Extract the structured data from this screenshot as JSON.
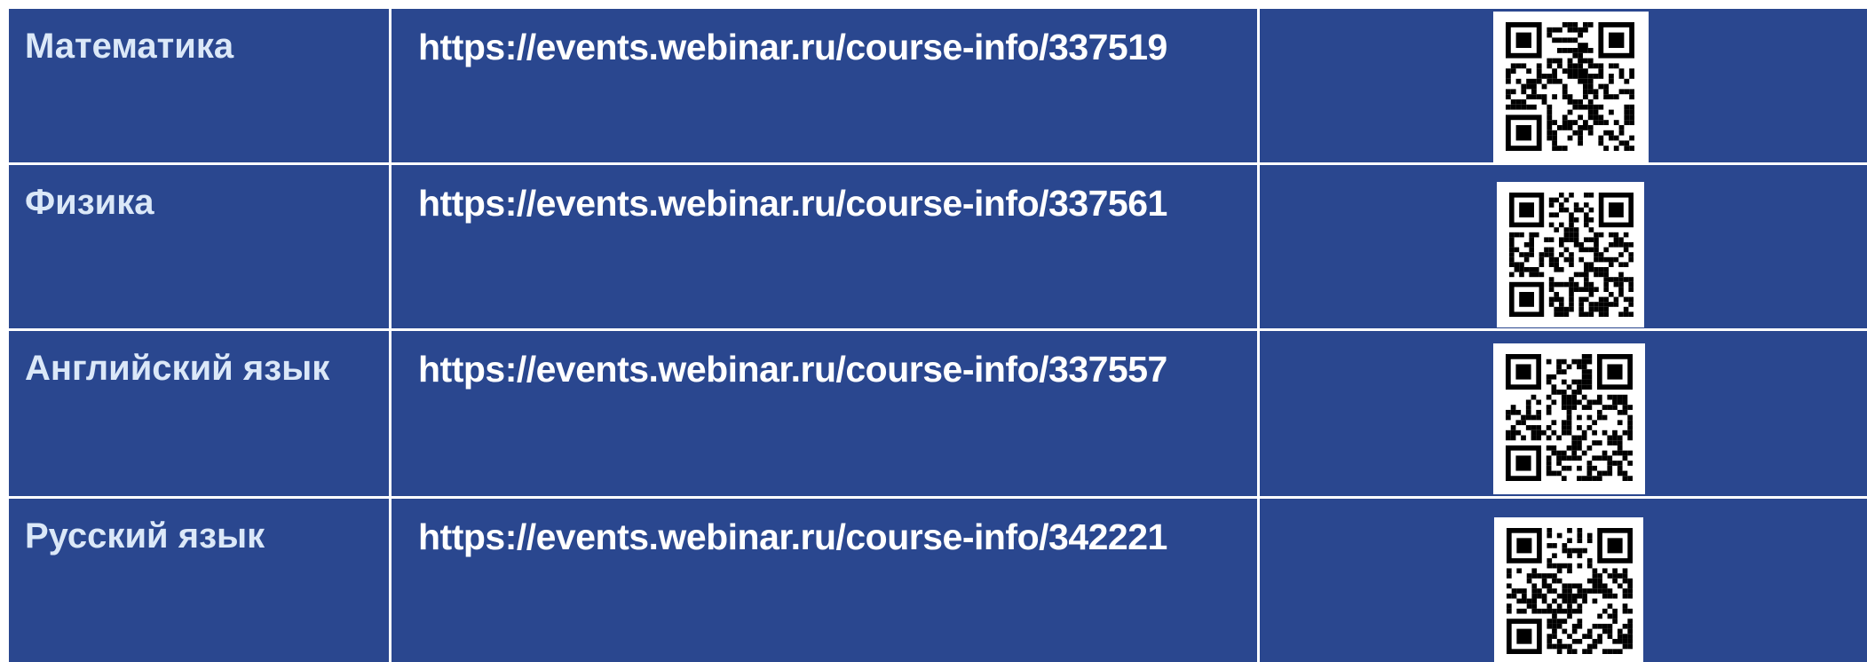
{
  "rows": [
    {
      "subject": "Математика",
      "url": "https://events.webinar.ru/course-info/337519",
      "qr_icon": "qr-code-icon"
    },
    {
      "subject": "Физика",
      "url": "https://events.webinar.ru/course-info/337561",
      "qr_icon": "qr-code-icon"
    },
    {
      "subject": "Английский язык",
      "url": "https://events.webinar.ru/course-info/337557",
      "qr_icon": "qr-code-icon"
    },
    {
      "subject": "Русский язык",
      "url": "https://events.webinar.ru/course-info/342221",
      "qr_icon": "qr-code-icon"
    }
  ],
  "colors": {
    "cell_background": "#2a478f",
    "border": "#ffffff",
    "subject_text": "#dbe8f8",
    "url_text": "#ffffff"
  }
}
